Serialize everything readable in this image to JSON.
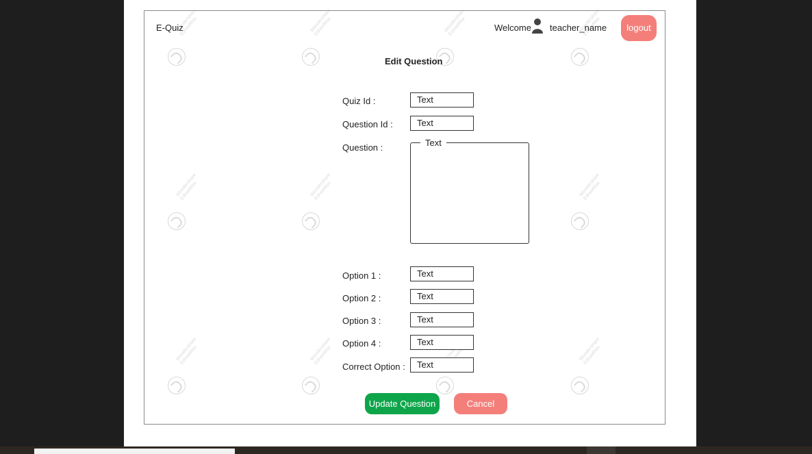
{
  "header": {
    "brand": "E-Quiz",
    "welcome": "Welcome",
    "user_icon": "user-icon",
    "username": "teacher_name",
    "logout_label": "logout"
  },
  "form": {
    "title": "Edit Question",
    "quiz_id": {
      "label": "Quiz Id :",
      "value": "Text"
    },
    "question_id": {
      "label": "Question Id :",
      "value": "Text"
    },
    "question": {
      "label": "Question :",
      "value": "Text"
    },
    "option1": {
      "label": "Option 1 :",
      "value": "Text"
    },
    "option2": {
      "label": "Option 2 :",
      "value": "Text"
    },
    "option3": {
      "label": "Option 3 :",
      "value": "Text"
    },
    "option4": {
      "label": "Option 4 :",
      "value": "Text"
    },
    "correct_option": {
      "label": "Correct Option :",
      "value": "Text"
    }
  },
  "actions": {
    "update_label": "Update Question",
    "cancel_label": "Cancel"
  },
  "watermark": {
    "line1": "Wondershare",
    "line2": "EdrawMax"
  },
  "colors": {
    "update_button": "#0ea54a",
    "cancel_button": "#f47f7a",
    "logout_button": "#f47f7a",
    "side_panels": "#1e1e1e"
  }
}
